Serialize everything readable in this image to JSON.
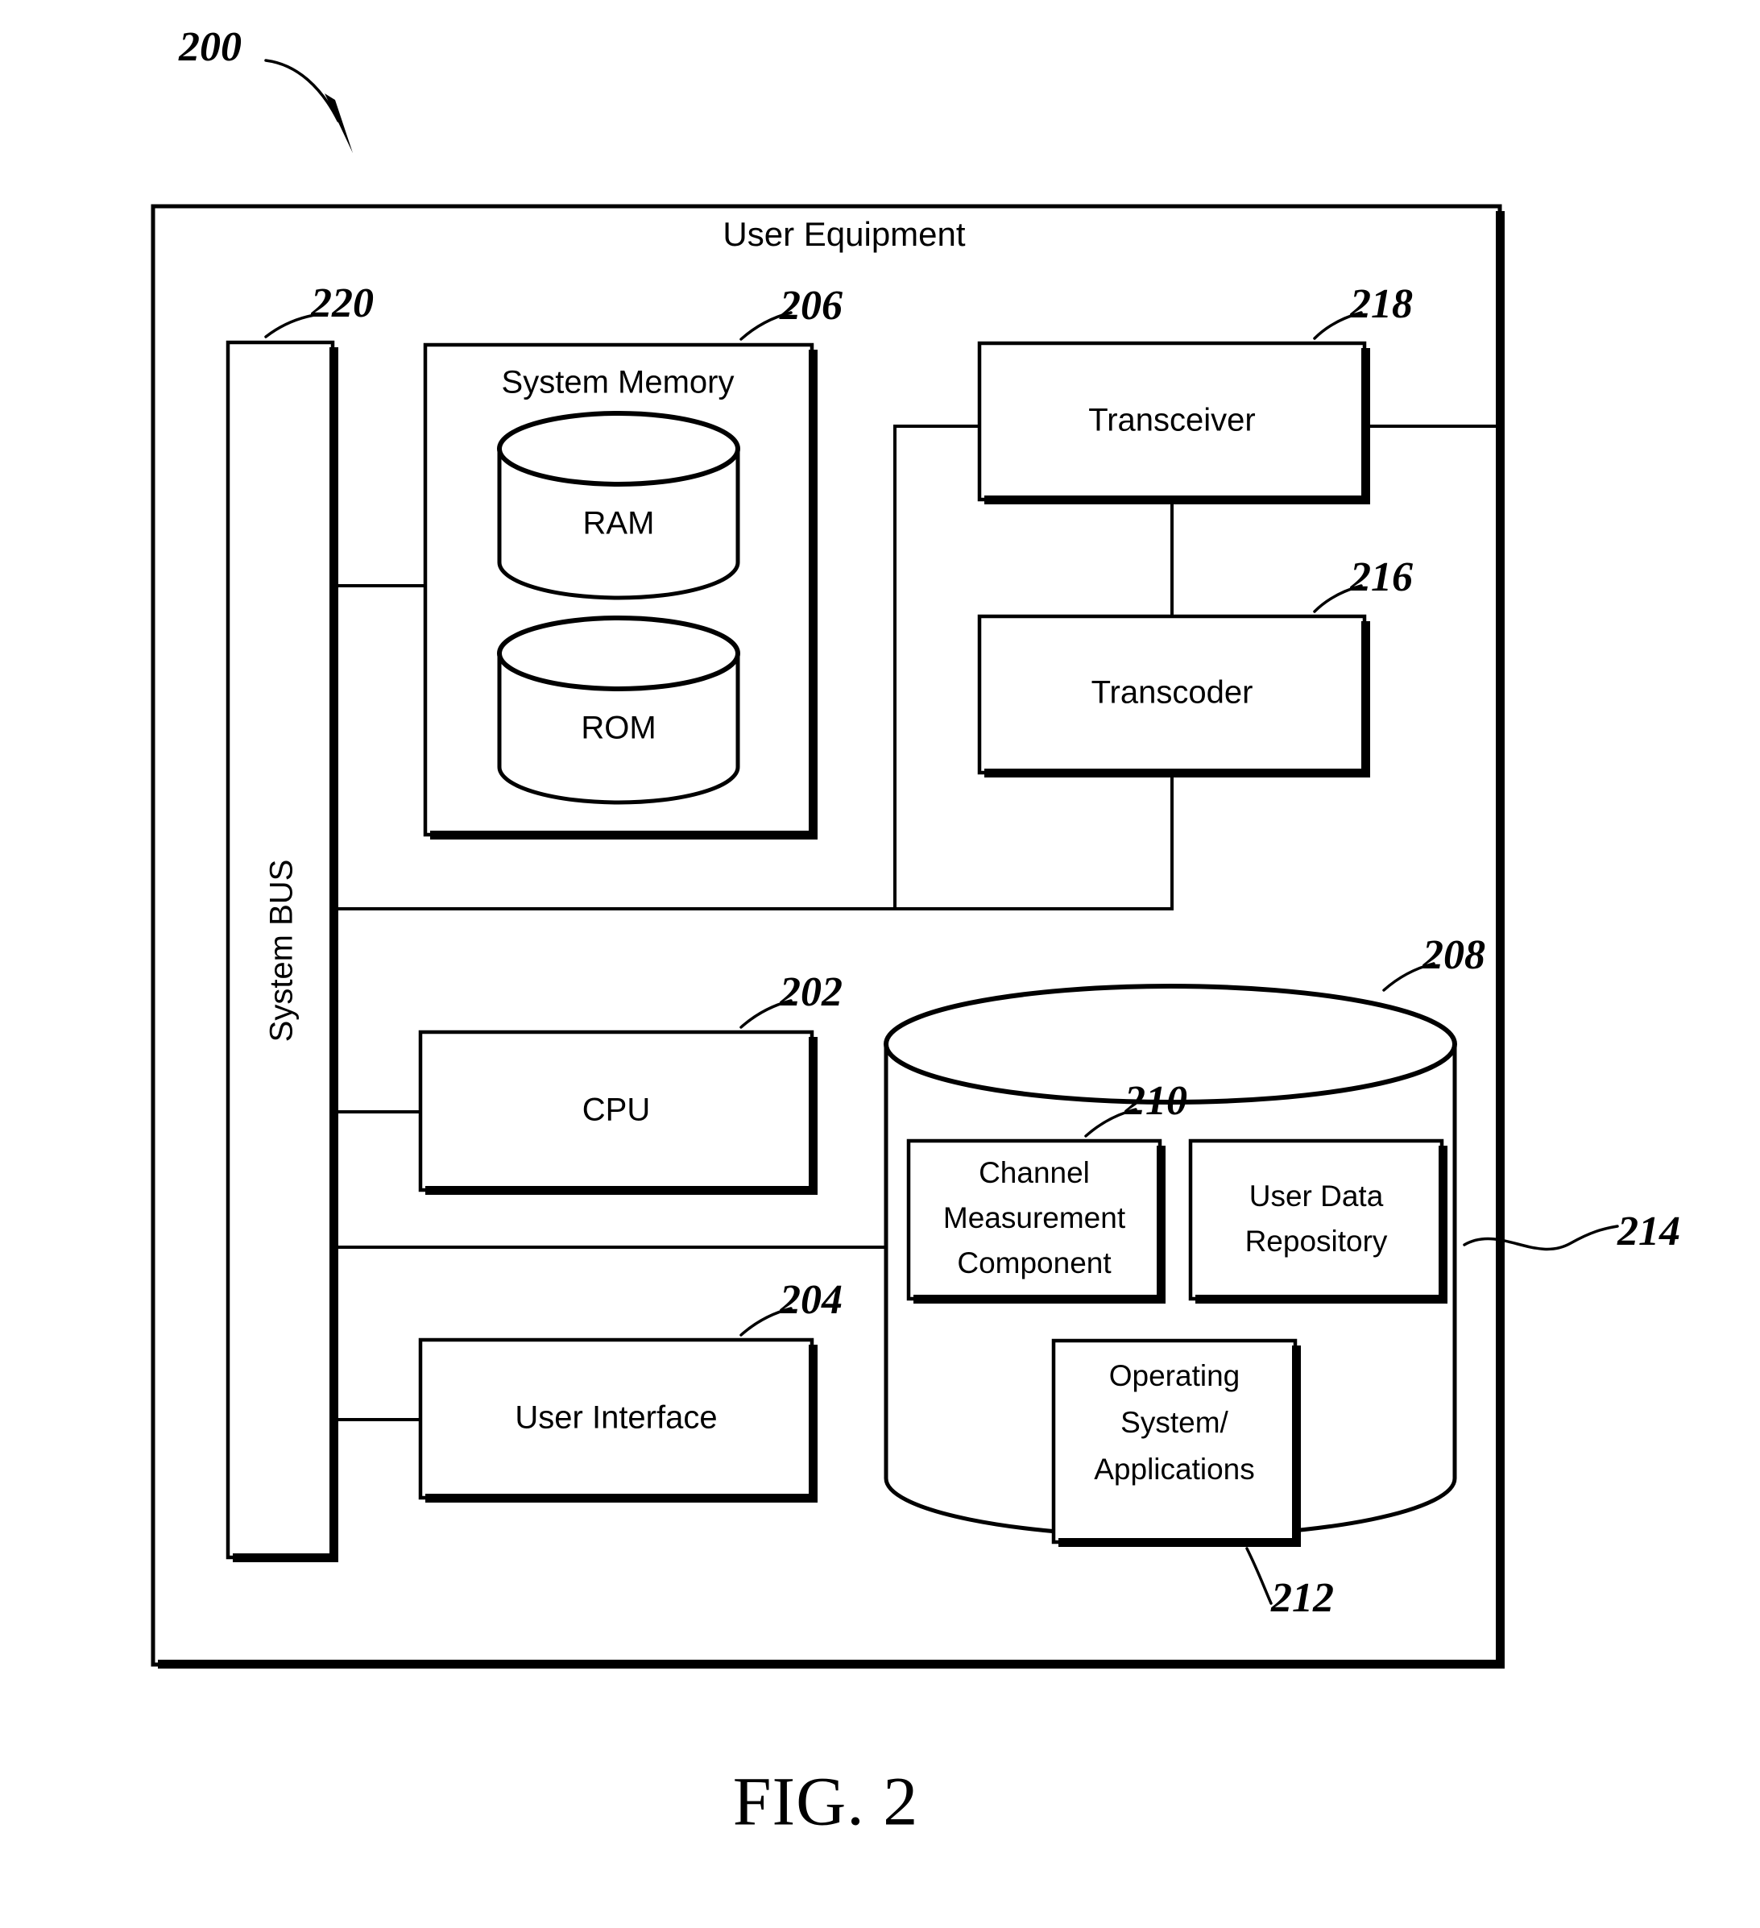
{
  "figure": {
    "caption": "FIG. 2",
    "root_ref": "200",
    "container_title": "User Equipment"
  },
  "refs": {
    "system": "200",
    "cpu": "202",
    "user_interface": "204",
    "system_memory": "206",
    "data_store": "208",
    "channel_measurement_component": "210",
    "operating_system_applications": "212",
    "user_data_repository": "214",
    "transcoder": "216",
    "transceiver": "218",
    "system_bus": "220"
  },
  "blocks": {
    "system_bus": {
      "label": "System BUS",
      "ref": "220"
    },
    "system_memory": {
      "label": "System Memory",
      "ref": "206"
    },
    "ram": {
      "label": "RAM"
    },
    "rom": {
      "label": "ROM"
    },
    "transceiver": {
      "label": "Transceiver",
      "ref": "218"
    },
    "transcoder": {
      "label": "Transcoder",
      "ref": "216"
    },
    "cpu": {
      "label": "CPU",
      "ref": "202"
    },
    "user_interface": {
      "label": "User Interface",
      "ref": "204"
    },
    "data_store": {
      "ref": "208"
    },
    "channel_measurement": {
      "line1": "Channel",
      "line2": "Measurement",
      "line3": "Component",
      "ref": "210"
    },
    "user_data_repository": {
      "line1": "User Data",
      "line2": "Repository",
      "ref": "214"
    },
    "operating_system": {
      "line1": "Operating",
      "line2": "System/",
      "line3": "Applications",
      "ref": "212"
    }
  },
  "colors": {
    "ink": "#000000",
    "paper": "#ffffff"
  }
}
